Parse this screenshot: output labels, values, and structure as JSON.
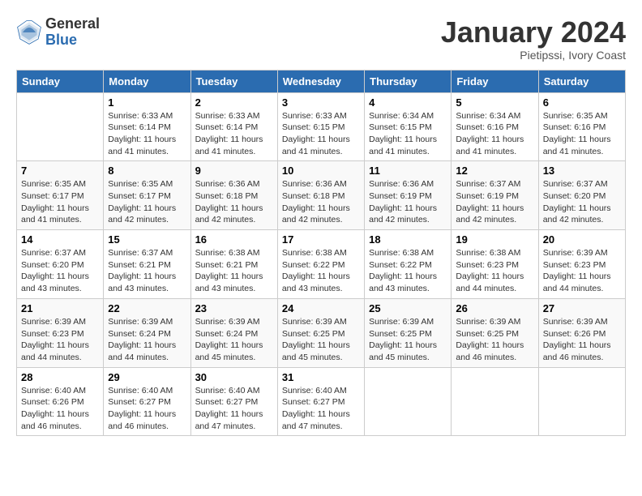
{
  "logo": {
    "general": "General",
    "blue": "Blue"
  },
  "title": "January 2024",
  "subtitle": "Pietipssi, Ivory Coast",
  "days_of_week": [
    "Sunday",
    "Monday",
    "Tuesday",
    "Wednesday",
    "Thursday",
    "Friday",
    "Saturday"
  ],
  "weeks": [
    [
      {
        "day": "",
        "detail": ""
      },
      {
        "day": "1",
        "detail": "Sunrise: 6:33 AM\nSunset: 6:14 PM\nDaylight: 11 hours and 41 minutes."
      },
      {
        "day": "2",
        "detail": "Sunrise: 6:33 AM\nSunset: 6:14 PM\nDaylight: 11 hours and 41 minutes."
      },
      {
        "day": "3",
        "detail": "Sunrise: 6:33 AM\nSunset: 6:15 PM\nDaylight: 11 hours and 41 minutes."
      },
      {
        "day": "4",
        "detail": "Sunrise: 6:34 AM\nSunset: 6:15 PM\nDaylight: 11 hours and 41 minutes."
      },
      {
        "day": "5",
        "detail": "Sunrise: 6:34 AM\nSunset: 6:16 PM\nDaylight: 11 hours and 41 minutes."
      },
      {
        "day": "6",
        "detail": "Sunrise: 6:35 AM\nSunset: 6:16 PM\nDaylight: 11 hours and 41 minutes."
      }
    ],
    [
      {
        "day": "7",
        "detail": "Sunrise: 6:35 AM\nSunset: 6:17 PM\nDaylight: 11 hours and 41 minutes."
      },
      {
        "day": "8",
        "detail": "Sunrise: 6:35 AM\nSunset: 6:17 PM\nDaylight: 11 hours and 42 minutes."
      },
      {
        "day": "9",
        "detail": "Sunrise: 6:36 AM\nSunset: 6:18 PM\nDaylight: 11 hours and 42 minutes."
      },
      {
        "day": "10",
        "detail": "Sunrise: 6:36 AM\nSunset: 6:18 PM\nDaylight: 11 hours and 42 minutes."
      },
      {
        "day": "11",
        "detail": "Sunrise: 6:36 AM\nSunset: 6:19 PM\nDaylight: 11 hours and 42 minutes."
      },
      {
        "day": "12",
        "detail": "Sunrise: 6:37 AM\nSunset: 6:19 PM\nDaylight: 11 hours and 42 minutes."
      },
      {
        "day": "13",
        "detail": "Sunrise: 6:37 AM\nSunset: 6:20 PM\nDaylight: 11 hours and 42 minutes."
      }
    ],
    [
      {
        "day": "14",
        "detail": "Sunrise: 6:37 AM\nSunset: 6:20 PM\nDaylight: 11 hours and 43 minutes."
      },
      {
        "day": "15",
        "detail": "Sunrise: 6:37 AM\nSunset: 6:21 PM\nDaylight: 11 hours and 43 minutes."
      },
      {
        "day": "16",
        "detail": "Sunrise: 6:38 AM\nSunset: 6:21 PM\nDaylight: 11 hours and 43 minutes."
      },
      {
        "day": "17",
        "detail": "Sunrise: 6:38 AM\nSunset: 6:22 PM\nDaylight: 11 hours and 43 minutes."
      },
      {
        "day": "18",
        "detail": "Sunrise: 6:38 AM\nSunset: 6:22 PM\nDaylight: 11 hours and 43 minutes."
      },
      {
        "day": "19",
        "detail": "Sunrise: 6:38 AM\nSunset: 6:23 PM\nDaylight: 11 hours and 44 minutes."
      },
      {
        "day": "20",
        "detail": "Sunrise: 6:39 AM\nSunset: 6:23 PM\nDaylight: 11 hours and 44 minutes."
      }
    ],
    [
      {
        "day": "21",
        "detail": "Sunrise: 6:39 AM\nSunset: 6:23 PM\nDaylight: 11 hours and 44 minutes."
      },
      {
        "day": "22",
        "detail": "Sunrise: 6:39 AM\nSunset: 6:24 PM\nDaylight: 11 hours and 44 minutes."
      },
      {
        "day": "23",
        "detail": "Sunrise: 6:39 AM\nSunset: 6:24 PM\nDaylight: 11 hours and 45 minutes."
      },
      {
        "day": "24",
        "detail": "Sunrise: 6:39 AM\nSunset: 6:25 PM\nDaylight: 11 hours and 45 minutes."
      },
      {
        "day": "25",
        "detail": "Sunrise: 6:39 AM\nSunset: 6:25 PM\nDaylight: 11 hours and 45 minutes."
      },
      {
        "day": "26",
        "detail": "Sunrise: 6:39 AM\nSunset: 6:25 PM\nDaylight: 11 hours and 46 minutes."
      },
      {
        "day": "27",
        "detail": "Sunrise: 6:39 AM\nSunset: 6:26 PM\nDaylight: 11 hours and 46 minutes."
      }
    ],
    [
      {
        "day": "28",
        "detail": "Sunrise: 6:40 AM\nSunset: 6:26 PM\nDaylight: 11 hours and 46 minutes."
      },
      {
        "day": "29",
        "detail": "Sunrise: 6:40 AM\nSunset: 6:27 PM\nDaylight: 11 hours and 46 minutes."
      },
      {
        "day": "30",
        "detail": "Sunrise: 6:40 AM\nSunset: 6:27 PM\nDaylight: 11 hours and 47 minutes."
      },
      {
        "day": "31",
        "detail": "Sunrise: 6:40 AM\nSunset: 6:27 PM\nDaylight: 11 hours and 47 minutes."
      },
      {
        "day": "",
        "detail": ""
      },
      {
        "day": "",
        "detail": ""
      },
      {
        "day": "",
        "detail": ""
      }
    ]
  ]
}
